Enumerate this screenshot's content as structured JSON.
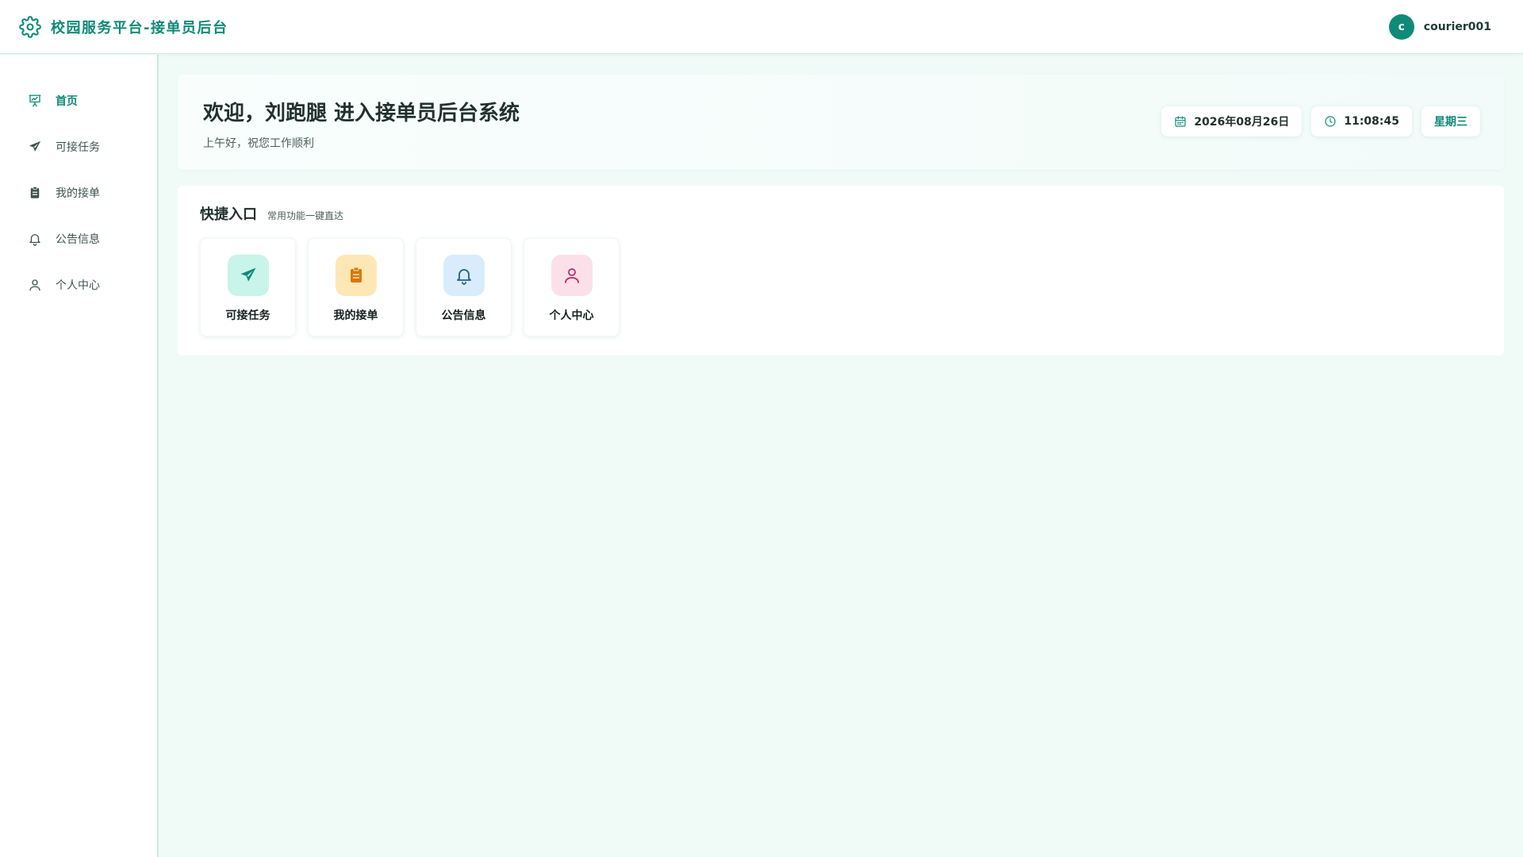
{
  "header": {
    "title": "校园服务平台-接单员后台",
    "avatar_letter": "c",
    "username": "courier001"
  },
  "sidebar": {
    "items": [
      {
        "label": "首页",
        "icon": "presentation-chart-icon",
        "active": true
      },
      {
        "label": "可接任务",
        "icon": "paper-plane-icon",
        "active": false
      },
      {
        "label": "我的接单",
        "icon": "clipboard-icon",
        "active": false
      },
      {
        "label": "公告信息",
        "icon": "bell-icon",
        "active": false
      },
      {
        "label": "个人中心",
        "icon": "user-icon",
        "active": false
      }
    ]
  },
  "welcome": {
    "title": "欢迎，刘跑腿 进入接单员后台系统",
    "subtitle": "上午好，祝您工作顺利",
    "date": "2026年08月26日",
    "time": "11:08:45",
    "weekday": "星期三"
  },
  "quick": {
    "title": "快捷入口",
    "subtitle": "常用功能一键直达",
    "cards": [
      {
        "label": "可接任务",
        "icon": "paper-plane-icon",
        "color": "#0f8a78",
        "bg": "#c9f4ea"
      },
      {
        "label": "我的接单",
        "icon": "clipboard-icon",
        "color": "#d97706",
        "bg": "#fde7b4"
      },
      {
        "label": "公告信息",
        "icon": "bell-icon",
        "color": "#1e5f8c",
        "bg": "#d9ecfb"
      },
      {
        "label": "个人中心",
        "icon": "user-icon",
        "color": "#c0266a",
        "bg": "#fbe0ea"
      }
    ]
  },
  "colors": {
    "accent": "#0f8a78",
    "background": "#f0fbf8"
  }
}
